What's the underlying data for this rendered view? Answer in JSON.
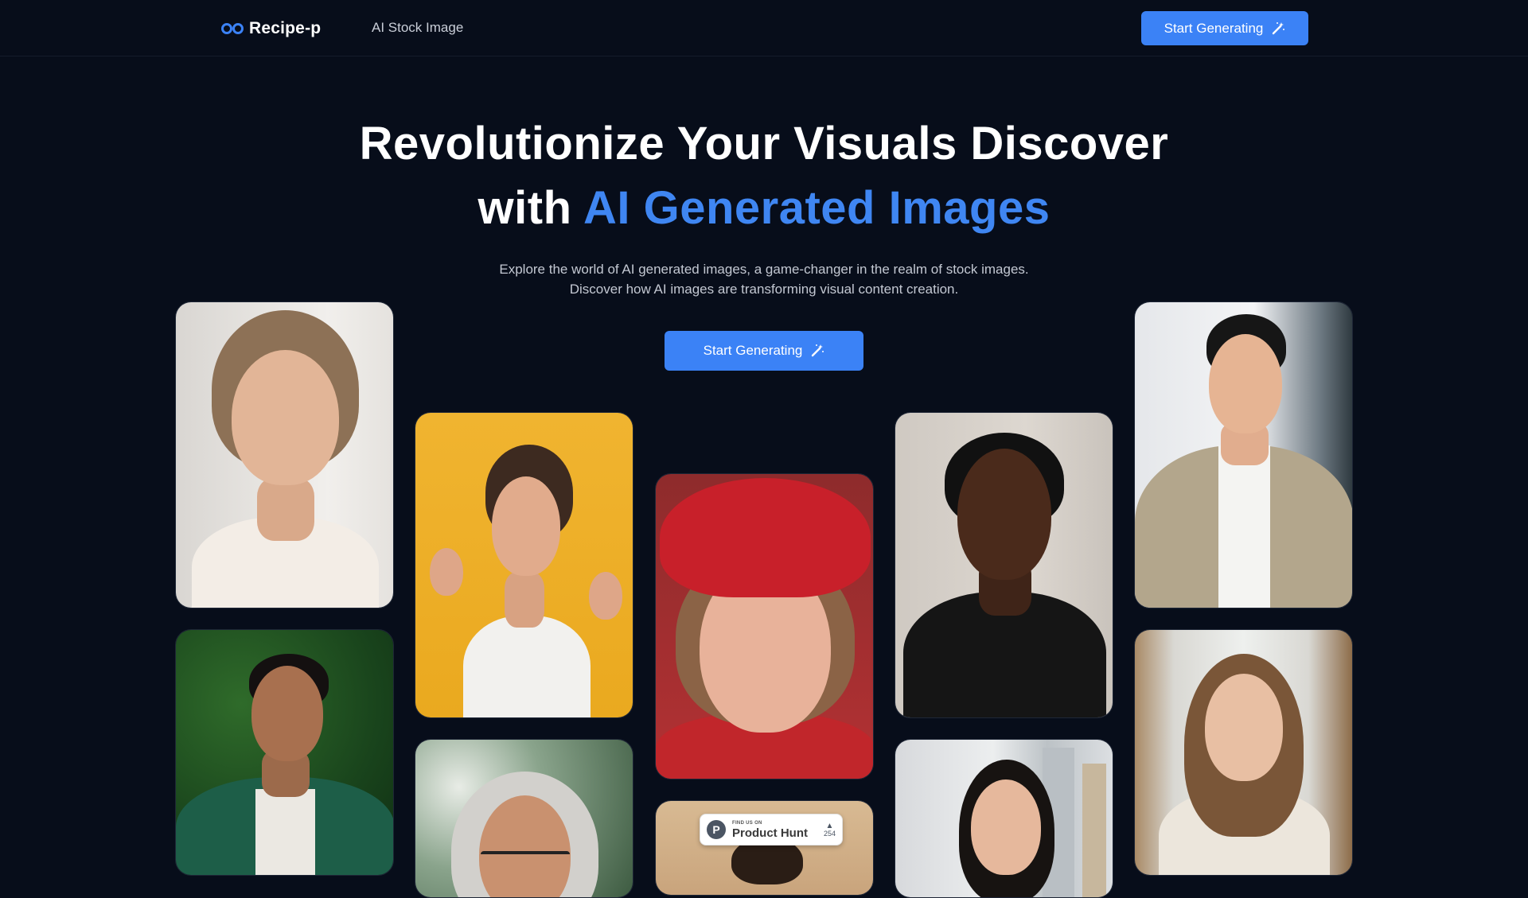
{
  "header": {
    "logo_text": "Recipe-p",
    "nav_link": "AI Stock Image",
    "cta_label": "Start Generating"
  },
  "hero": {
    "title_line1": "Revolutionize Your Visuals Discover",
    "title_line2_plain": "with ",
    "title_line2_accent": "AI Generated Images",
    "subtitle_line1": "Explore the world of AI generated images, a game-changer in the realm of stock images.",
    "subtitle_line2": "Discover how AI images are transforming visual content creation.",
    "cta_label": "Start Generating"
  },
  "gallery": {
    "images": [
      "young woman portrait",
      "excited woman yellow background",
      "elderly woman red beret",
      "woman dark top",
      "man in tweed blazer",
      "man green blazer",
      "grey-haired woman glasses",
      "partially hidden portrait",
      "young woman city background",
      "girl by bookshelf"
    ]
  },
  "product_hunt_badge": {
    "small_label": "FIND US ON",
    "name": "Product Hunt",
    "votes": "254"
  },
  "colors": {
    "background": "#070d1a",
    "accent": "#3b82f6",
    "accent_text": "#3f86f2"
  },
  "icons": [
    "logo-infinity-icon",
    "magic-wand-icon",
    "upvote-arrow-icon"
  ]
}
